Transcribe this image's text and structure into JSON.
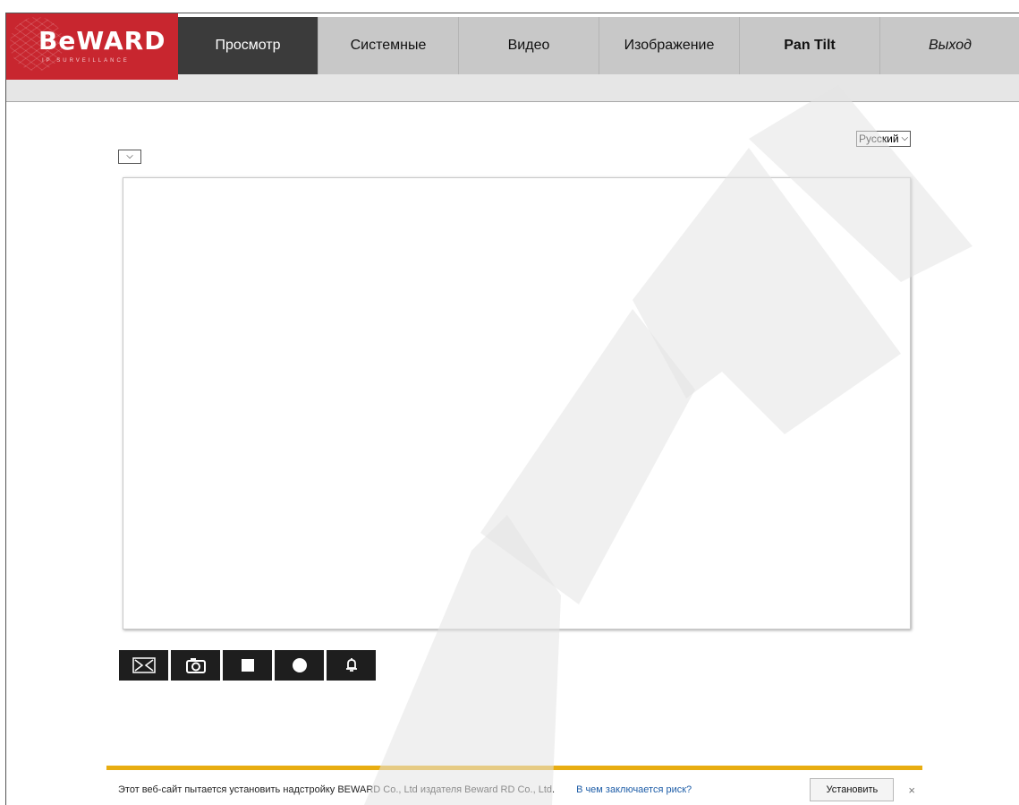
{
  "logo": {
    "word": "BeWARD",
    "sub": "IP SURVEILLANCE"
  },
  "nav": {
    "tabs": [
      "Просмотр",
      "Системные",
      "Видео",
      "Изображение",
      "Pan Tilt",
      "Выход"
    ]
  },
  "language": {
    "selected": "Русский"
  },
  "controls": {
    "icons": [
      "fullscreen-icon",
      "snapshot-icon",
      "stop-icon",
      "record-icon",
      "alarm-bell-icon"
    ]
  },
  "notification": {
    "text": "Этот веб-сайт пытается установить надстройку BEWARD Co., Ltd издателя Beward RD Co., Ltd.",
    "link": "В чем заключается риск?",
    "install_label": "Установить",
    "close": "×"
  },
  "colors": {
    "brand": "#c8262f",
    "active_tab": "#3b3b3b",
    "notify_accent": "#e8ad11"
  }
}
